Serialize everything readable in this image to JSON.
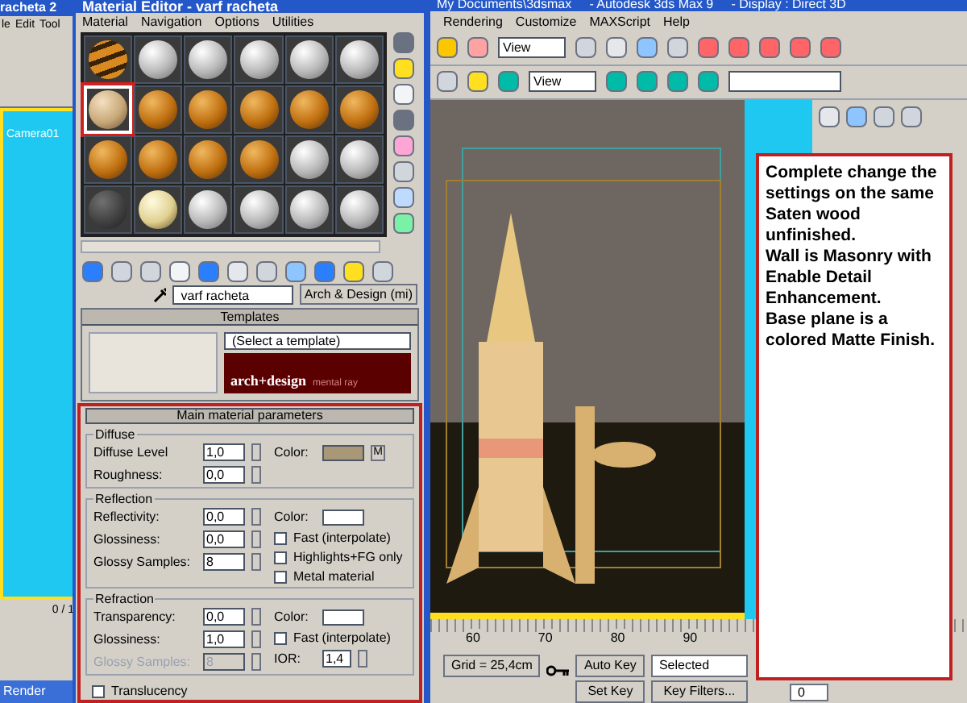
{
  "background_window": {
    "title": "racheta 2",
    "menu": [
      "le",
      "Edit",
      "Tool"
    ],
    "viewport_label": "Camera01",
    "frame_counter": "0 / 1",
    "taskbar_button": "Render"
  },
  "material_editor": {
    "title": "Material Editor - varf racheta",
    "menu": [
      "Material",
      "Navigation",
      "Options",
      "Utilities"
    ],
    "slots": [
      {
        "kind": "striped",
        "selected": false
      },
      {
        "kind": "white",
        "selected": false
      },
      {
        "kind": "white",
        "selected": false
      },
      {
        "kind": "white",
        "selected": false
      },
      {
        "kind": "white",
        "selected": false
      },
      {
        "kind": "white",
        "selected": false
      },
      {
        "kind": "beige",
        "selected": true
      },
      {
        "kind": "orange",
        "selected": false
      },
      {
        "kind": "orange",
        "selected": false
      },
      {
        "kind": "orange",
        "selected": false
      },
      {
        "kind": "orange",
        "selected": false
      },
      {
        "kind": "orange",
        "selected": false
      },
      {
        "kind": "orange",
        "selected": false
      },
      {
        "kind": "orange",
        "selected": false
      },
      {
        "kind": "orange",
        "selected": false
      },
      {
        "kind": "orange",
        "selected": false
      },
      {
        "kind": "white",
        "selected": false
      },
      {
        "kind": "white",
        "selected": false
      },
      {
        "kind": "dark",
        "selected": false
      },
      {
        "kind": "cream",
        "selected": false
      },
      {
        "kind": "white",
        "selected": false
      },
      {
        "kind": "white",
        "selected": false
      },
      {
        "kind": "white",
        "selected": false
      },
      {
        "kind": "white",
        "selected": false
      }
    ],
    "material_name": "varf racheta",
    "material_type": "Arch & Design (mi)",
    "templates": {
      "title": "Templates",
      "select": "(Select a template)",
      "logo": "arch+design",
      "logo_sub": "mental ray"
    },
    "main_params": {
      "title": "Main material parameters",
      "groups": [
        {
          "title": "Diffuse",
          "fields": [
            {
              "label": "Diffuse Level",
              "value": "1,0",
              "disabled": false
            },
            {
              "label": "Roughness:",
              "value": "0,0",
              "disabled": false
            }
          ],
          "color_label": "Color:",
          "color": "#a89878",
          "map_button": "M"
        },
        {
          "title": "Reflection",
          "fields": [
            {
              "label": "Reflectivity:",
              "value": "0,0",
              "disabled": false
            },
            {
              "label": "Glossiness:",
              "value": "0,0",
              "disabled": false
            },
            {
              "label": "Glossy Samples:",
              "value": "8",
              "disabled": false
            }
          ],
          "color_label": "Color:",
          "color": "#ffffff",
          "checks": [
            {
              "label": "Fast (interpolate)",
              "checked": false
            },
            {
              "label": "Highlights+FG only",
              "checked": false
            },
            {
              "label": "Metal material",
              "checked": false
            }
          ]
        },
        {
          "title": "Refraction",
          "fields": [
            {
              "label": "Transparency:",
              "value": "0,0",
              "disabled": false
            },
            {
              "label": "Glossiness:",
              "value": "1,0",
              "disabled": false
            },
            {
              "label": "Glossy Samples:",
              "value": "8",
              "disabled": true
            }
          ],
          "color_label": "Color:",
          "color": "#ffffff",
          "checks": [
            {
              "label": "Fast (interpolate)",
              "checked": false
            }
          ],
          "ior_label": "IOR:",
          "ior": "1,4"
        }
      ],
      "translucency": {
        "label": "Translucency",
        "checked": false
      }
    }
  },
  "main_window": {
    "title": "My Documents\\3dsmax     - Autodesk 3ds Max 9     - Display : Direct 3D",
    "menu": [
      "Rendering",
      "Customize",
      "MAXScript",
      "Help"
    ],
    "view_dropdowns": [
      "View",
      "View"
    ],
    "ruler_ticks": [
      "60",
      "70",
      "80",
      "90"
    ],
    "grid": "Grid = 25,4cm",
    "auto_key": "Auto Key",
    "key_mode": "Selected",
    "set_key": "Set Key",
    "key_filters": "Key Filters...",
    "frame": "0"
  },
  "note": "Complete change the settings on the same Saten wood unfinished.\nWall is Masonry with Enable Detail Enhancement.\nBase plane is a colored Matte Finish."
}
